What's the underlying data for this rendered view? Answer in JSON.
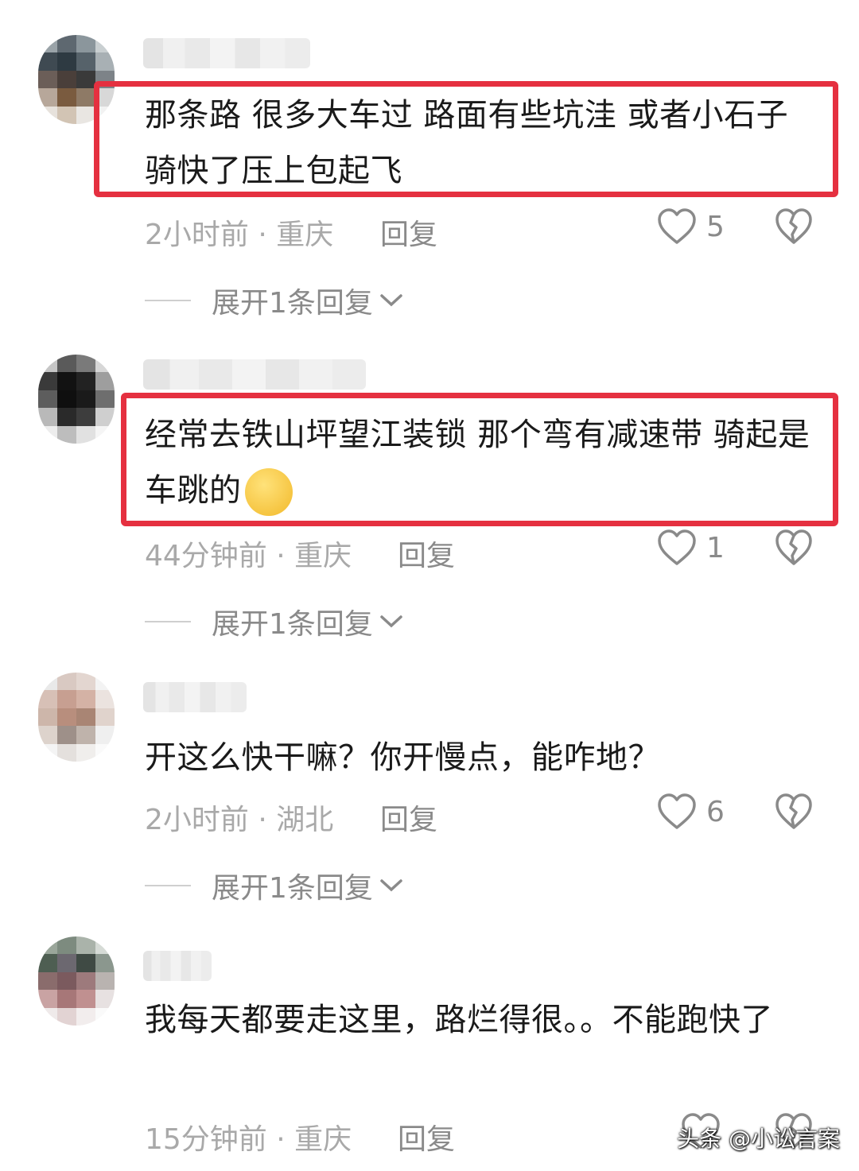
{
  "comments": [
    {
      "text": "那条路 很多大车过 路面有些坑洼 或者小石子 骑快了压上包起飞",
      "meta": "2小时前 · 重庆",
      "reply": "回复",
      "likes": "5",
      "expand": "展开1条回复"
    },
    {
      "text": "经常去铁山坪望江装锁  那个弯有减速带 骑起是车跳的",
      "emoji": "😥",
      "meta": "44分钟前 · 重庆",
      "reply": "回复",
      "likes": "1",
      "expand": "展开1条回复"
    },
    {
      "text": "开这么快干嘛？你开慢点，能咋地？",
      "meta": "2小时前 · 湖北",
      "reply": "回复",
      "likes": "6",
      "expand": "展开1条回复"
    },
    {
      "text": "我每天都要走这里，路烂得很。。不能跑快了",
      "meta": "15分钟前 · 重庆",
      "reply": "回复"
    }
  ],
  "watermark": "头条 @小讼言案",
  "colors": {
    "highlight": "#e53040",
    "meta": "#a9a9a9",
    "muted": "#8a8a8a"
  },
  "icons": [
    "heart-outline-icon",
    "broken-heart-icon",
    "chevron-down-icon"
  ]
}
